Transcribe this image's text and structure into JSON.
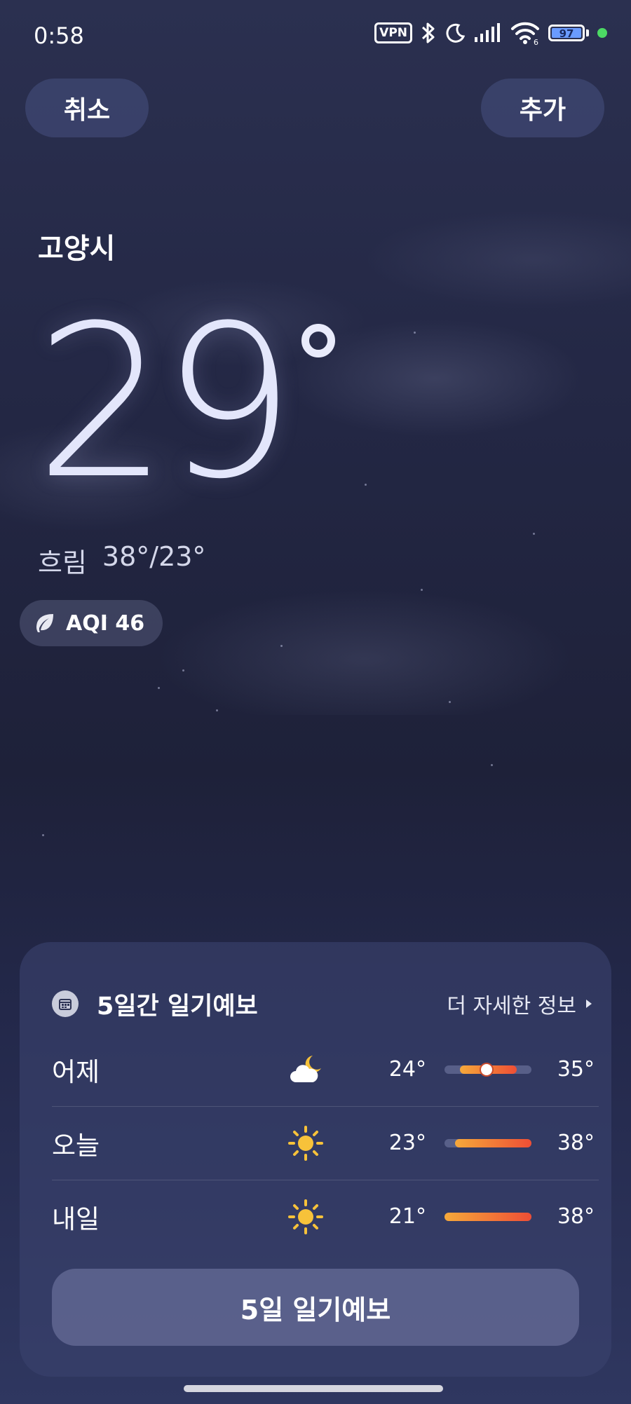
{
  "status_bar": {
    "time": "0:58",
    "vpn_label": "VPN",
    "battery_level": "97",
    "wifi_badge": "6"
  },
  "header": {
    "cancel_label": "취소",
    "add_label": "추가"
  },
  "current": {
    "city": "고양시",
    "temperature": "29",
    "condition": "흐림",
    "high_low": "38°/23°",
    "aqi_label": "AQI 46"
  },
  "forecast": {
    "title": "5일간 일기예보",
    "more_label": "더 자세한 정보",
    "days": [
      {
        "day": "어제",
        "icon": "partly-cloudy-night-icon",
        "low": "24°",
        "high": "35°",
        "bar_start": 0.18,
        "bar_end": 0.83,
        "current_marker": 0.48
      },
      {
        "day": "오늘",
        "icon": "sun-icon",
        "low": "23°",
        "high": "38°",
        "bar_start": 0.12,
        "bar_end": 1.0
      },
      {
        "day": "내일",
        "icon": "sun-icon",
        "low": "21°",
        "high": "38°",
        "bar_start": 0.0,
        "bar_end": 1.0
      }
    ],
    "button_label": "5일 일기예보"
  },
  "colors": {
    "accent_sun": "#f7c23a",
    "bar_start": "#f6a93a",
    "bar_end": "#ee4e35",
    "status_dot": "#4cd964"
  }
}
